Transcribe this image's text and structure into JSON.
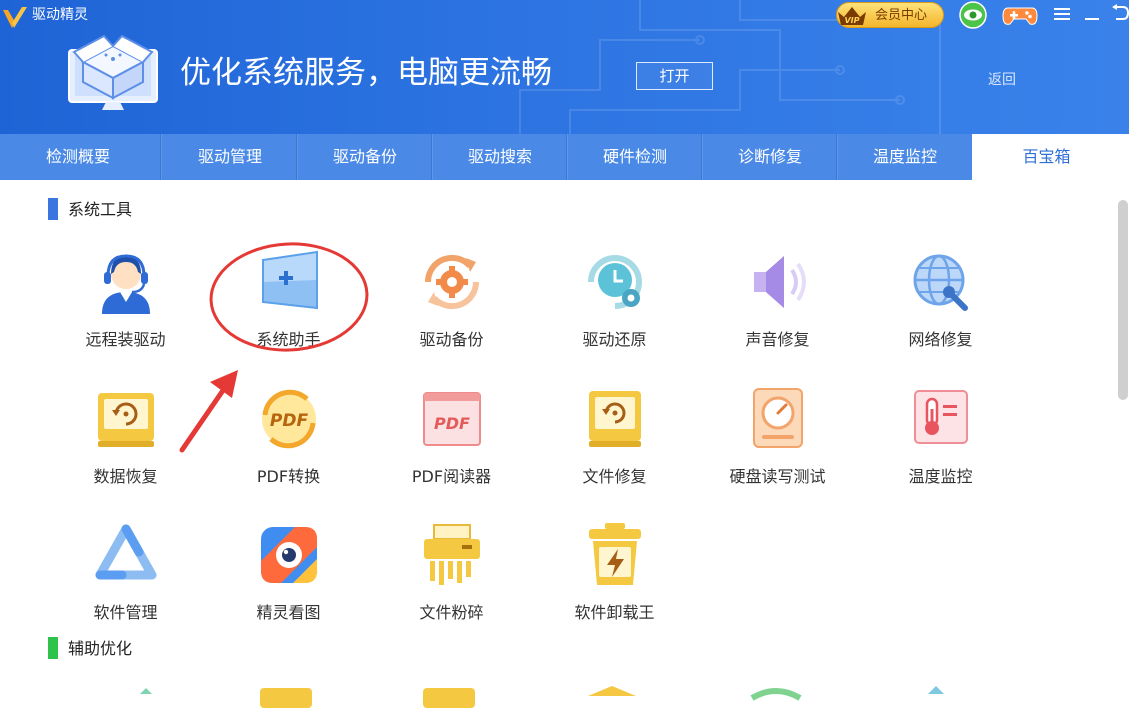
{
  "app": {
    "title": "驱动精灵"
  },
  "header": {
    "vip_label": "会员中心",
    "vip_badge": "VIP",
    "headline": "优化系统服务，电脑更流畅",
    "open_label": "打开",
    "back_label": "返回"
  },
  "tabs": [
    {
      "label": "检测概要"
    },
    {
      "label": "驱动管理"
    },
    {
      "label": "驱动备份"
    },
    {
      "label": "驱动搜索"
    },
    {
      "label": "硬件检测"
    },
    {
      "label": "诊断修复"
    },
    {
      "label": "温度监控"
    },
    {
      "label": "百宝箱",
      "active": true
    }
  ],
  "sections": [
    {
      "title": "系统工具",
      "marker_color": "#3b76e0",
      "tools": [
        {
          "label": "远程装驱动",
          "icon": "headset-person-icon"
        },
        {
          "label": "系统助手",
          "icon": "windows-plus-icon",
          "highlighted": true
        },
        {
          "label": "驱动备份",
          "icon": "gear-refresh-icon"
        },
        {
          "label": "驱动还原",
          "icon": "clock-gear-icon"
        },
        {
          "label": "声音修复",
          "icon": "speaker-icon"
        },
        {
          "label": "网络修复",
          "icon": "globe-wrench-icon"
        },
        {
          "label": "数据恢复",
          "icon": "restore-disk-icon"
        },
        {
          "label": "PDF转换",
          "icon": "pdf-circle-icon"
        },
        {
          "label": "PDF阅读器",
          "icon": "pdf-window-icon"
        },
        {
          "label": "文件修复",
          "icon": "file-restore-icon"
        },
        {
          "label": "硬盘读写测试",
          "icon": "disk-gauge-icon"
        },
        {
          "label": "温度监控",
          "icon": "thermometer-icon"
        },
        {
          "label": "软件管理",
          "icon": "triangle-icon"
        },
        {
          "label": "精灵看图",
          "icon": "image-eye-icon"
        },
        {
          "label": "文件粉碎",
          "icon": "shredder-icon"
        },
        {
          "label": "软件卸载王",
          "icon": "lightning-bin-icon"
        }
      ]
    },
    {
      "title": "辅助优化",
      "marker_color": "#2ec34a"
    }
  ],
  "colors": {
    "header_blue": "#2d74e2",
    "tab_blue": "#4a8ae6",
    "active_tab_text": "#2f6fd8",
    "annotation_red": "#e53935"
  }
}
